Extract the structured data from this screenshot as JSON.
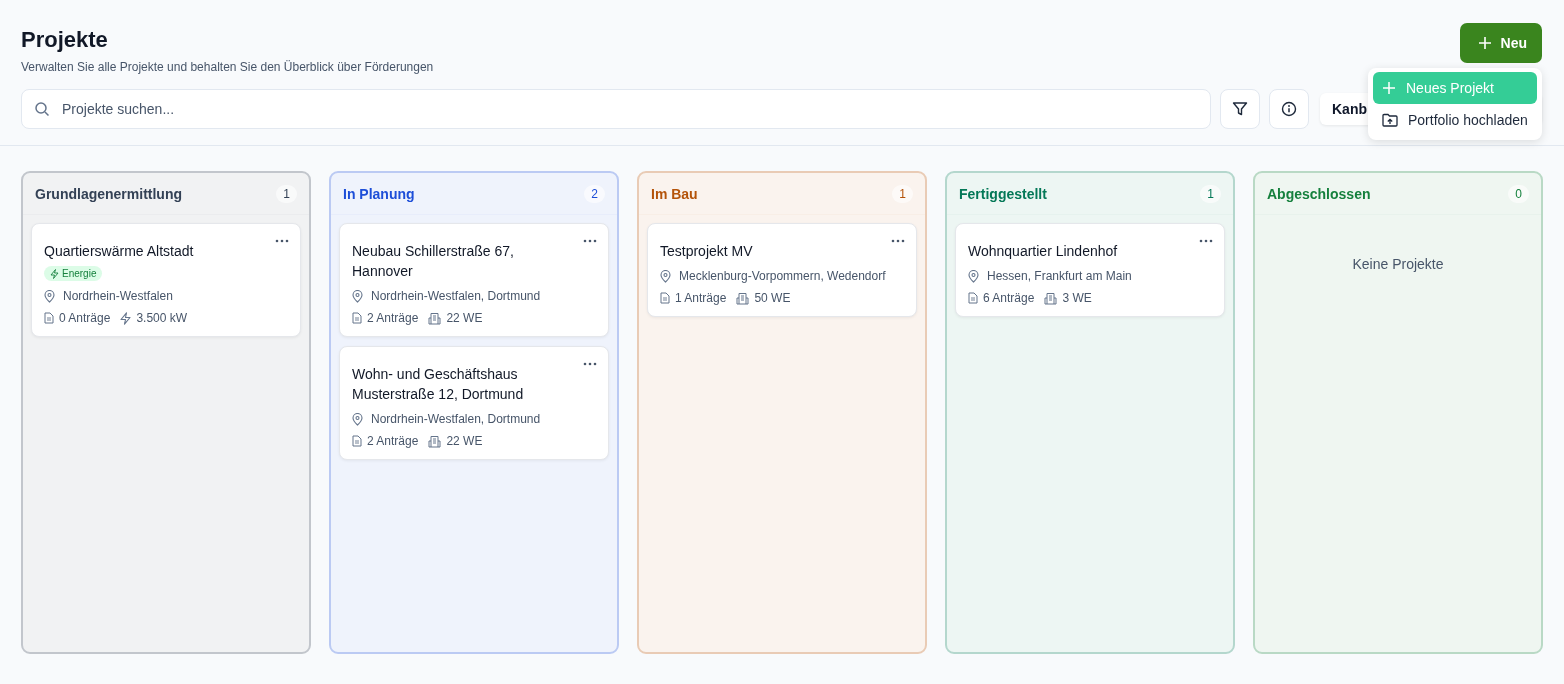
{
  "header": {
    "title": "Projekte",
    "subtitle": "Verwalten Sie alle Projekte und behalten Sie den Überblick über Förderungen",
    "new_button": "Neu"
  },
  "search": {
    "placeholder": "Projekte suchen..."
  },
  "view_toggle": {
    "label": "Kanb"
  },
  "menu": {
    "items": [
      {
        "kind": "add",
        "label": "Neues Projekt",
        "selected": true
      },
      {
        "kind": "upload",
        "label": "Portfolio hochladen",
        "selected": false
      }
    ]
  },
  "columns": [
    {
      "title": "Grundlagenermittlung",
      "count": "1",
      "color": "#334155",
      "cards": [
        {
          "title": "Quartierswärme Altstadt",
          "tags": [
            {
              "label": "Energie"
            }
          ],
          "location": "Nordrhein-Westfalen",
          "stats": [
            {
              "kind": "documents",
              "label": "0 Anträge"
            },
            {
              "kind": "power",
              "label": "3.500 kW"
            }
          ]
        }
      ]
    },
    {
      "title": "In Planung",
      "count": "2",
      "color": "#1d4ed8",
      "cards": [
        {
          "title": "Neubau Schillerstraße 67, Hannover",
          "location": "Nordrhein-Westfalen, Dortmund",
          "stats": [
            {
              "kind": "documents",
              "label": "2 Anträge"
            },
            {
              "kind": "units",
              "label": "22 WE"
            }
          ]
        },
        {
          "title": "Wohn- und Geschäftshaus Musterstraße 12, Dortmund",
          "location": "Nordrhein-Westfalen, Dortmund",
          "stats": [
            {
              "kind": "documents",
              "label": "2 Anträge"
            },
            {
              "kind": "units",
              "label": "22 WE"
            }
          ]
        }
      ]
    },
    {
      "title": "Im Bau",
      "count": "1",
      "color": "#b45309",
      "cards": [
        {
          "title": "Testprojekt MV",
          "location": "Mecklenburg-Vorpommern, Wedendorf",
          "stats": [
            {
              "kind": "documents",
              "label": "1 Anträge"
            },
            {
              "kind": "units",
              "label": "50 WE"
            }
          ]
        }
      ]
    },
    {
      "title": "Fertiggestellt",
      "count": "1",
      "color": "#047857",
      "cards": [
        {
          "title": "Wohnquartier Lindenhof",
          "location": "Hessen, Frankfurt am Main",
          "stats": [
            {
              "kind": "documents",
              "label": "6 Anträge"
            },
            {
              "kind": "units",
              "label": "3 WE"
            }
          ]
        }
      ]
    },
    {
      "title": "Abgeschlossen",
      "count": "0",
      "color": "#15803d",
      "empty": "Keine Projekte"
    }
  ]
}
